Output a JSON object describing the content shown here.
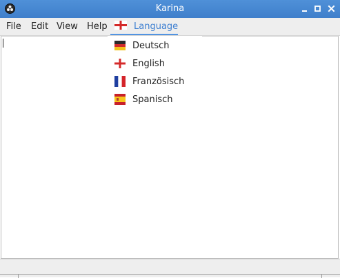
{
  "window": {
    "title": "Karina"
  },
  "menubar": {
    "items": [
      {
        "label": "File"
      },
      {
        "label": "Edit"
      },
      {
        "label": "View"
      },
      {
        "label": "Help"
      },
      {
        "label": "Language",
        "icon": "english-flag-icon",
        "active": true
      }
    ]
  },
  "language_menu": {
    "items": [
      {
        "label": "Deutsch",
        "icon": "german-flag-icon"
      },
      {
        "label": "English",
        "icon": "english-flag-icon"
      },
      {
        "label": "Französisch",
        "icon": "french-flag-icon"
      },
      {
        "label": "Spanisch",
        "icon": "spanish-flag-icon"
      }
    ]
  },
  "colors": {
    "titlebar": "#3f7fcb",
    "accent": "#5294e2",
    "menubar": "#eeeeee"
  }
}
